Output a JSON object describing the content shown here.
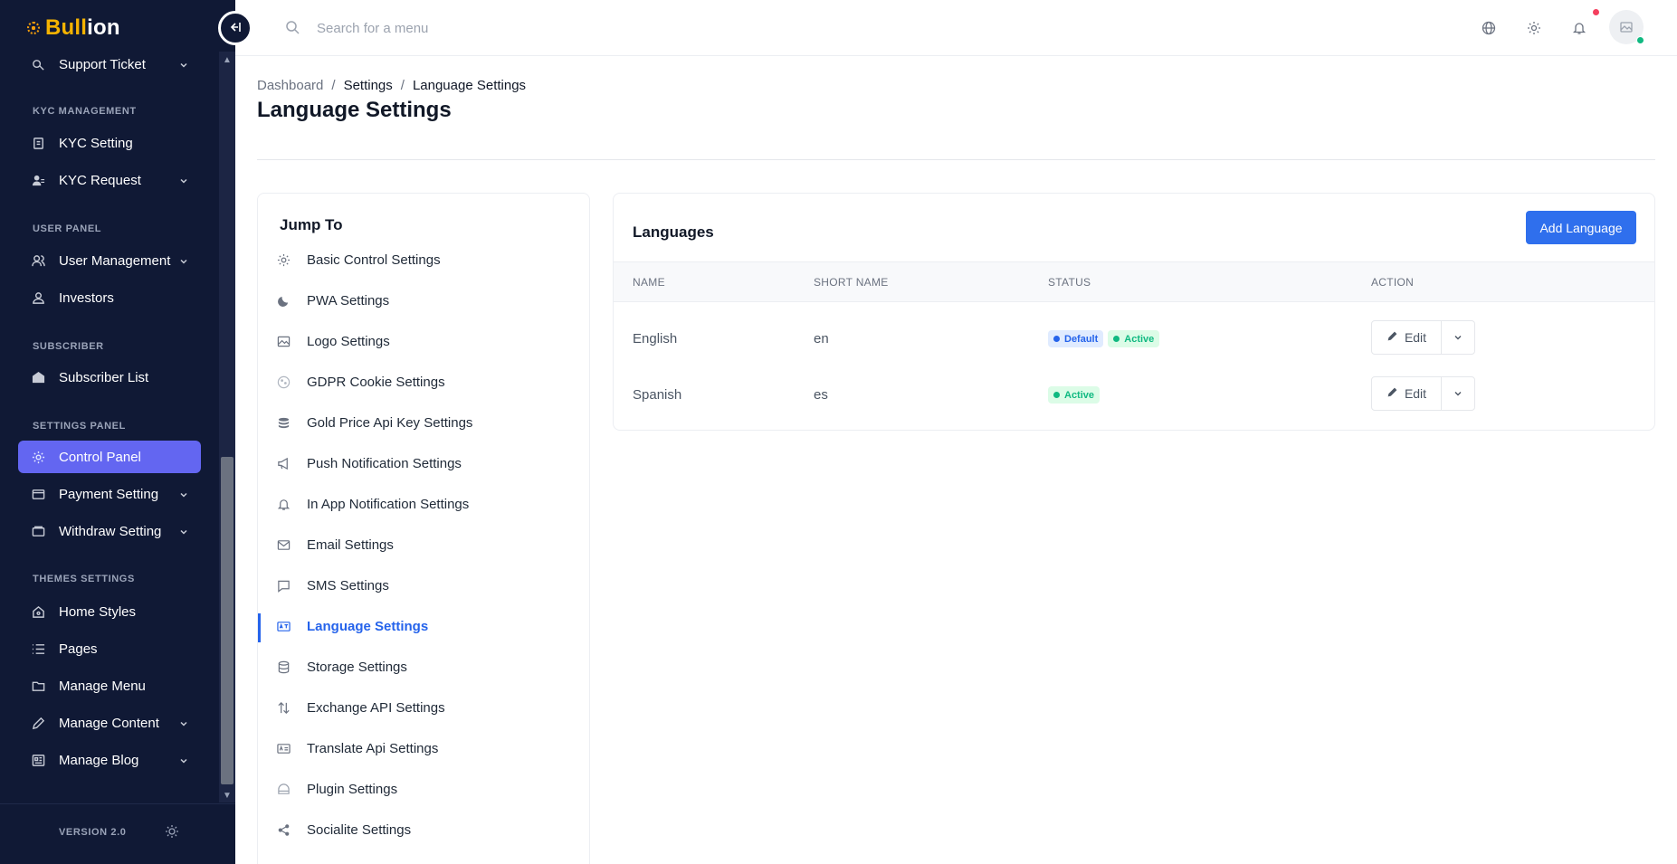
{
  "brand": {
    "name_part1": "Bull",
    "name_part2": "ion"
  },
  "sidebar": {
    "sections": [
      {
        "title": "KYC MANAGEMENT"
      },
      {
        "title": "USER PANEL"
      },
      {
        "title": "SUBSCRIBER"
      },
      {
        "title": "SETTINGS PANEL"
      },
      {
        "title": "THEMES SETTINGS"
      }
    ],
    "items": [
      {
        "label": "Support Ticket",
        "icon": "support-icon",
        "chevron": true
      },
      {
        "label": "KYC Setting",
        "icon": "document-icon",
        "chevron": false
      },
      {
        "label": "KYC Request",
        "icon": "users-icon",
        "chevron": true
      },
      {
        "label": "User Management",
        "icon": "users-icon",
        "chevron": true
      },
      {
        "label": "Investors",
        "icon": "user-icon",
        "chevron": false
      },
      {
        "label": "Subscriber List",
        "icon": "mail-open-icon",
        "chevron": false
      },
      {
        "label": "Control Panel",
        "icon": "gear-icon",
        "chevron": false,
        "active": true
      },
      {
        "label": "Payment Setting",
        "icon": "wallet-icon",
        "chevron": true
      },
      {
        "label": "Withdraw Setting",
        "icon": "wallet-icon",
        "chevron": true
      },
      {
        "label": "Home Styles",
        "icon": "home-icon",
        "chevron": false
      },
      {
        "label": "Pages",
        "icon": "list-icon",
        "chevron": false
      },
      {
        "label": "Manage Menu",
        "icon": "folder-icon",
        "chevron": false
      },
      {
        "label": "Manage Content",
        "icon": "pencil-icon",
        "chevron": true
      },
      {
        "label": "Manage Blog",
        "icon": "blog-icon",
        "chevron": true
      }
    ],
    "version": "VERSION 2.0"
  },
  "topbar": {
    "search_placeholder": "Search for a menu"
  },
  "breadcrumb": {
    "home": "Dashboard",
    "parent": "Settings",
    "current": "Language Settings"
  },
  "page_title": "Language Settings",
  "jump_to": {
    "title": "Jump To",
    "items": [
      {
        "label": "Basic Control Settings",
        "icon": "gear-icon"
      },
      {
        "label": "PWA Settings",
        "icon": "moon-icon"
      },
      {
        "label": "Logo Settings",
        "icon": "image-icon"
      },
      {
        "label": "GDPR Cookie Settings",
        "icon": "cookie-icon"
      },
      {
        "label": "Gold Price Api Key Settings",
        "icon": "coins-icon"
      },
      {
        "label": "Push Notification Settings",
        "icon": "megaphone-icon"
      },
      {
        "label": "In App Notification Settings",
        "icon": "bell-icon"
      },
      {
        "label": "Email Settings",
        "icon": "envelope-icon"
      },
      {
        "label": "SMS Settings",
        "icon": "chat-icon"
      },
      {
        "label": "Language Settings",
        "icon": "language-icon",
        "active": true
      },
      {
        "label": "Storage Settings",
        "icon": "database-icon"
      },
      {
        "label": "Exchange API Settings",
        "icon": "exchange-icon"
      },
      {
        "label": "Translate Api Settings",
        "icon": "translate-icon"
      },
      {
        "label": "Plugin Settings",
        "icon": "plugin-icon"
      },
      {
        "label": "Socialite Settings",
        "icon": "share-icon"
      }
    ]
  },
  "languages": {
    "title": "Languages",
    "add_button": "Add Language",
    "columns": [
      "NAME",
      "SHORT NAME",
      "STATUS",
      "ACTION"
    ],
    "rows": [
      {
        "name": "English",
        "short": "en",
        "badges": [
          "Default",
          "Active"
        ],
        "edit": "Edit"
      },
      {
        "name": "Spanish",
        "short": "es",
        "badges": [
          "Active"
        ],
        "edit": "Edit"
      }
    ]
  }
}
